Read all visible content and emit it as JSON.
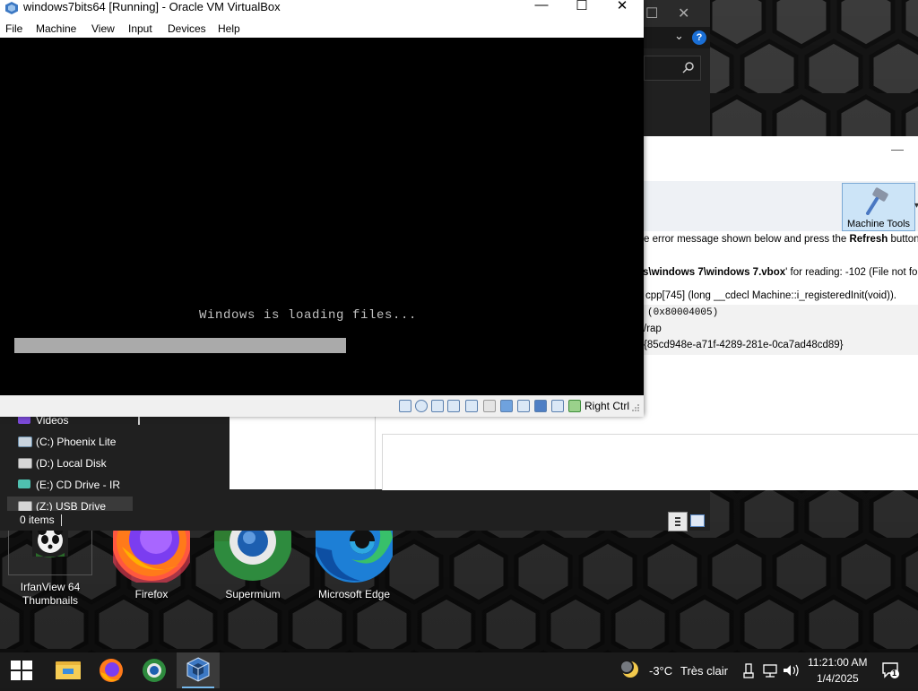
{
  "vm_window": {
    "title": "windows7bits64 [Running] - Oracle VM VirtualBox",
    "controls": {
      "minimize": "—",
      "maximize": "☐",
      "close": "✕"
    },
    "menu": [
      "File",
      "Machine",
      "View",
      "Input",
      "Devices",
      "Help"
    ],
    "screen": {
      "boot_message": "Windows is loading files...",
      "progress_fraction": 0.64
    },
    "status_icons": [
      "hard-disk-icon",
      "optical-drive-icon",
      "audio-icon",
      "network-icon",
      "usb-icon",
      "shared-folders-icon",
      "display-icon",
      "video-capture-icon",
      "graphics-icon",
      "virtualization-icon",
      "mouse-integration-icon",
      "keyboard-capture-icon"
    ],
    "host_key": "Right Ctrl"
  },
  "vbox_manager": {
    "toolbar": {
      "machine_tools_label": "Machine Tools"
    },
    "message_prefix": "e error message shown below and press the ",
    "message_bold": "Refresh",
    "message_suffix": " button if t",
    "error_path_bold": "s\\windows 7\\windows 7.vbox",
    "error_path_rest": "' for reading: -102 (File not fo",
    "details": {
      "location": "cpp[745] (long __cdecl Machine::i_registeredInit(void)).",
      "result_code": "(0x80004005)",
      "component": "/rap",
      "interface": "{85cd948e-a71f-4289-281e-0ca7ad48cd89}"
    }
  },
  "explorer": {
    "nav_items": [
      {
        "label": "Videos",
        "icon": "videos-folder-icon"
      },
      {
        "label": "(C:) Phoenix Lite",
        "icon": "drive-icon"
      },
      {
        "label": "(D:) Local Disk",
        "icon": "drive-icon"
      },
      {
        "label": "(E:) CD Drive - IR",
        "icon": "cd-drive-icon"
      },
      {
        "label": "(Z:) USB Drive",
        "icon": "usb-drive-icon"
      }
    ],
    "status_count": "0 items"
  },
  "desktop_icons": [
    {
      "label_line1": "IrfanView 64",
      "label_line2": "Thumbnails",
      "icon": "irfanview-icon"
    },
    {
      "label_line1": "Firefox",
      "label_line2": "",
      "icon": "firefox-icon"
    },
    {
      "label_line1": "Supermium",
      "label_line2": "",
      "icon": "supermium-icon"
    },
    {
      "label_line1": "Microsoft Edge",
      "label_line2": "",
      "icon": "edge-icon"
    }
  ],
  "taskbar": {
    "pinned": [
      "windows-start-icon",
      "file-explorer-icon",
      "firefox-icon",
      "supermium-icon",
      "virtualbox-icon"
    ],
    "weather_temp": "-3°C",
    "weather_condition": "Très clair",
    "time": "11:21:00 AM",
    "date": "1/4/2025",
    "notification_count": "1"
  },
  "colors": {
    "taskbar_accent": "#76b9ed",
    "vm_screen": "#000000",
    "boot_text": "#c0c0c0",
    "progress_fill": "#aaaaaa",
    "selected_tool": "#cce4f7"
  }
}
